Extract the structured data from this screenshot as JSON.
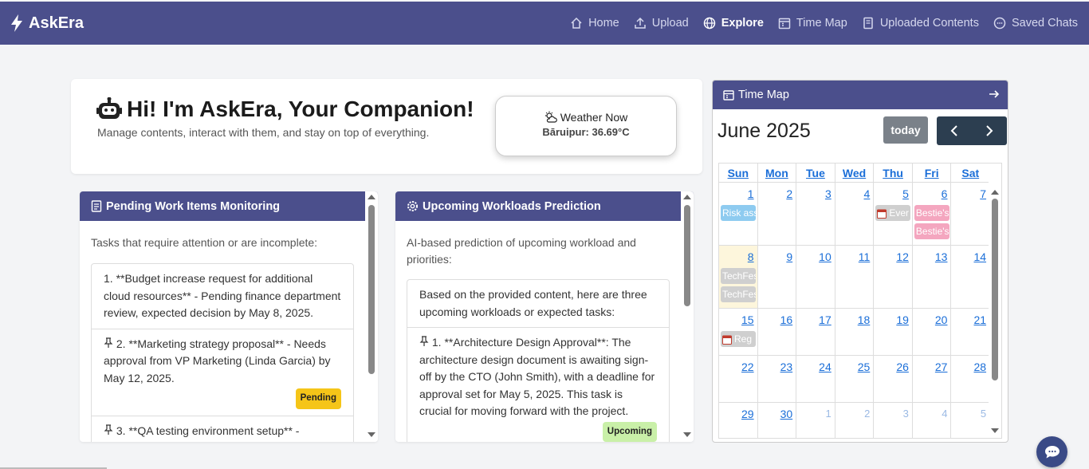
{
  "navbar": {
    "brand": "AskEra",
    "links": [
      {
        "label": "Home",
        "icon": "home-icon",
        "active": false
      },
      {
        "label": "Upload",
        "icon": "upload-icon",
        "active": false
      },
      {
        "label": "Explore",
        "icon": "globe-icon",
        "active": true
      },
      {
        "label": "Time Map",
        "icon": "calendar-icon",
        "active": false
      },
      {
        "label": "Uploaded Contents",
        "icon": "file-icon",
        "active": false
      },
      {
        "label": "Saved Chats",
        "icon": "chat-icon",
        "active": false
      }
    ]
  },
  "welcome": {
    "title": "Hi! I'm AskEra, Your Companion!",
    "subtitle": "Manage contents, interact with them, and stay on top of everything."
  },
  "weather": {
    "title": "Weather Now",
    "value": "Bāruipur: 36.69°C"
  },
  "pending_panel": {
    "title": "Pending Work Items Monitoring",
    "description": "Tasks that require attention or are incomplete:",
    "items": [
      {
        "text": "1. **Budget increase request for additional cloud resources** - Pending finance department review, expected decision by May 8, 2025."
      },
      {
        "text": "2. **Marketing strategy proposal** - Needs approval from VP Marketing (Linda Garcia) by May 12, 2025.",
        "badge": "Pending"
      },
      {
        "text": "3. **QA testing environment setup** -"
      }
    ]
  },
  "workload_panel": {
    "title": "Upcoming Workloads Prediction",
    "description": "AI-based prediction of upcoming workload and priorities:",
    "intro": "Based on the provided content, here are three upcoming workloads or expected tasks:",
    "items": [
      {
        "text": "1. **Architecture Design Approval**: The architecture design document is awaiting sign-off by the CTO (John Smith), with a deadline for approval set for May 5, 2025. This task is crucial for moving forward with the project.",
        "badge": "Upcoming"
      }
    ]
  },
  "calendar": {
    "header": "Time Map",
    "month_title": "June 2025",
    "today_label": "today",
    "days_of_week": [
      "Sun",
      "Mon",
      "Tue",
      "Wed",
      "Thu",
      "Fri",
      "Sat"
    ],
    "weeks": [
      [
        {
          "d": "1",
          "events": [
            {
              "label": "Risk ass",
              "color": "blue"
            }
          ]
        },
        {
          "d": "2"
        },
        {
          "d": "3"
        },
        {
          "d": "4"
        },
        {
          "d": "5",
          "events": [
            {
              "label": "Ever",
              "color": "gray",
              "icon": true
            }
          ]
        },
        {
          "d": "6",
          "events": [
            {
              "label": "Bestie's",
              "color": "pink"
            },
            {
              "label": "Bestie's",
              "color": "pink"
            }
          ]
        },
        {
          "d": "7"
        }
      ],
      [
        {
          "d": "8",
          "today": true,
          "events": [
            {
              "label": "TechFes",
              "color": "gray"
            },
            {
              "label": "TechFes",
              "color": "gray"
            }
          ]
        },
        {
          "d": "9"
        },
        {
          "d": "10"
        },
        {
          "d": "11"
        },
        {
          "d": "12"
        },
        {
          "d": "13"
        },
        {
          "d": "14"
        }
      ],
      [
        {
          "d": "15",
          "events": [
            {
              "label": "Reg",
              "color": "gray",
              "icon": true
            }
          ]
        },
        {
          "d": "16"
        },
        {
          "d": "17"
        },
        {
          "d": "18"
        },
        {
          "d": "19"
        },
        {
          "d": "20"
        },
        {
          "d": "21"
        }
      ],
      [
        {
          "d": "22"
        },
        {
          "d": "23"
        },
        {
          "d": "24"
        },
        {
          "d": "25"
        },
        {
          "d": "26"
        },
        {
          "d": "27"
        },
        {
          "d": "28"
        }
      ],
      [
        {
          "d": "29"
        },
        {
          "d": "30"
        },
        {
          "d": "1",
          "other": true
        },
        {
          "d": "2",
          "other": true
        },
        {
          "d": "3",
          "other": true
        },
        {
          "d": "4",
          "other": true
        },
        {
          "d": "5",
          "other": true
        }
      ]
    ]
  },
  "colors": {
    "primary": "#4b4f8c",
    "pending_badge": "#f5c518",
    "upcoming_badge": "#c9f0a8",
    "link": "#1a6ed8"
  }
}
